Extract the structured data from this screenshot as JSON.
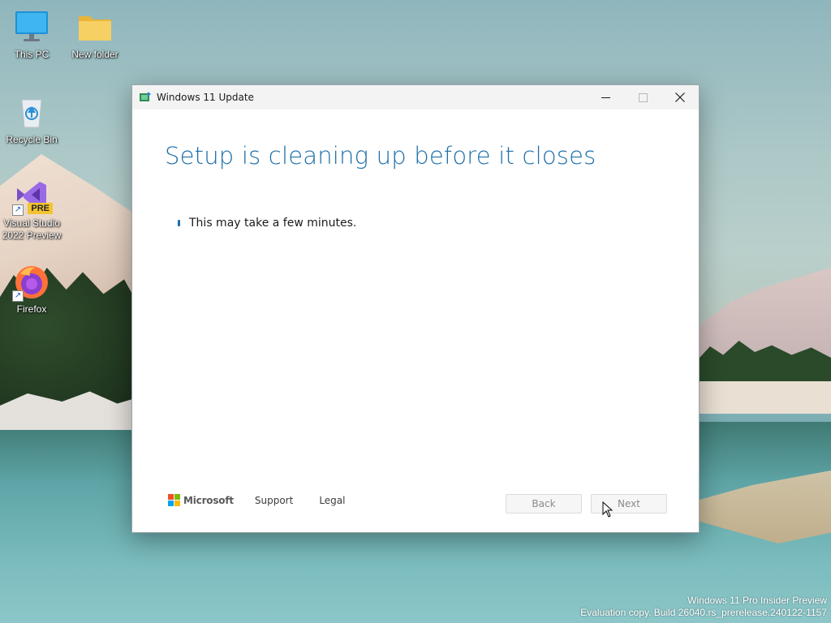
{
  "desktop": {
    "icons": [
      {
        "label": "This PC",
        "icon": "monitor-icon"
      },
      {
        "label": "New folder",
        "icon": "folder-icon"
      },
      {
        "label": "Recycle Bin",
        "icon": "recycle-bin-icon"
      },
      {
        "label": "Visual Studio 2022 Preview",
        "icon": "visual-studio-icon",
        "badge": "PRE"
      },
      {
        "label": "Firefox",
        "icon": "firefox-icon"
      }
    ],
    "watermark": {
      "line1": "Windows 11 Pro Insider Preview",
      "line2": "Evaluation copy. Build 26040.rs_prerelease.240122-1157"
    }
  },
  "window": {
    "title": "Windows 11 Update",
    "controls": {
      "minimize": "minimize-icon",
      "maximize": "maximize-icon",
      "close": "close-icon"
    },
    "heading": "Setup is cleaning up before it closes",
    "status_text": "This may take a few minutes.",
    "footer": {
      "brand": "Microsoft",
      "links": [
        "Support",
        "Legal"
      ]
    },
    "buttons": {
      "back": "Back",
      "next": "Next"
    }
  },
  "colors": {
    "accent": "#1d6fa8",
    "ms_red": "#f25022",
    "ms_green": "#7fba00",
    "ms_blue": "#00a4ef",
    "ms_yellow": "#ffb900"
  }
}
